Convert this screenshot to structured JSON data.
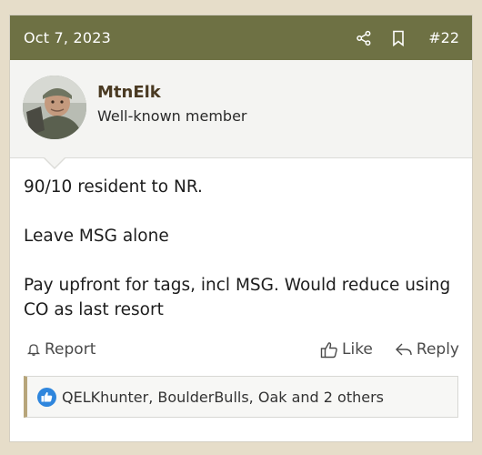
{
  "post": {
    "date": "Oct 7, 2023",
    "number": "#22",
    "icons": {
      "share": "share-icon",
      "bookmark": "bookmark-icon"
    }
  },
  "user": {
    "name": "MtnElk",
    "title": "Well-known member",
    "avatar": "avatar-photo"
  },
  "message": {
    "lines": [
      "90/10 resident to NR.",
      "Leave MSG alone",
      "Pay upfront for tags, incl MSG. Would reduce using CO as last resort"
    ]
  },
  "actions": {
    "report": "Report",
    "like": "Like",
    "reply": "Reply"
  },
  "reactions": {
    "text": "QELKhunter, BoulderBulls, Oak and 2 others"
  },
  "colors": {
    "header_bg": "#6e7144",
    "page_bg": "#e6ddc9",
    "like_blue": "#2f86dd",
    "reaction_accent": "#b7a57a"
  }
}
